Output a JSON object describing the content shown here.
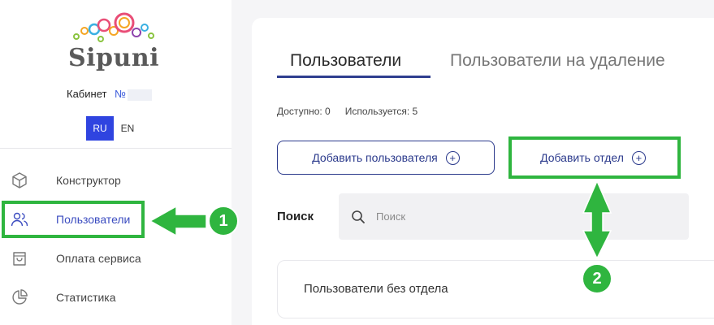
{
  "brand": {
    "logo_text": "Sipuni"
  },
  "cabinet": {
    "label": "Кабинет",
    "number_prefix": "№"
  },
  "language": {
    "options": [
      "RU",
      "EN"
    ],
    "selected": "RU"
  },
  "sidebar": {
    "items": [
      {
        "label": "Конструктор",
        "icon": "cube-icon"
      },
      {
        "label": "Пользователи",
        "icon": "users-icon",
        "active": true
      },
      {
        "label": "Оплата сервиса",
        "icon": "shopping-bag-icon"
      },
      {
        "label": "Статистика",
        "icon": "pie-chart-icon"
      }
    ]
  },
  "tabs": [
    {
      "label": "Пользователи",
      "active": true
    },
    {
      "label": "Пользователи на удаление",
      "active": false
    }
  ],
  "stats": {
    "available": "Доступно: 0",
    "used": "Используется: 5"
  },
  "actions": {
    "add_user": "Добавить пользователя",
    "add_department": "Добавить отдел"
  },
  "search": {
    "label": "Поиск",
    "placeholder": "Поиск"
  },
  "groups": [
    {
      "label": "Пользователи без отдела"
    }
  ],
  "annotations": [
    {
      "number": "1"
    },
    {
      "number": "2"
    }
  ],
  "colors": {
    "accent": "#2f44e0",
    "highlight": "#2fb53f",
    "text_primary": "#2b3a8c"
  }
}
